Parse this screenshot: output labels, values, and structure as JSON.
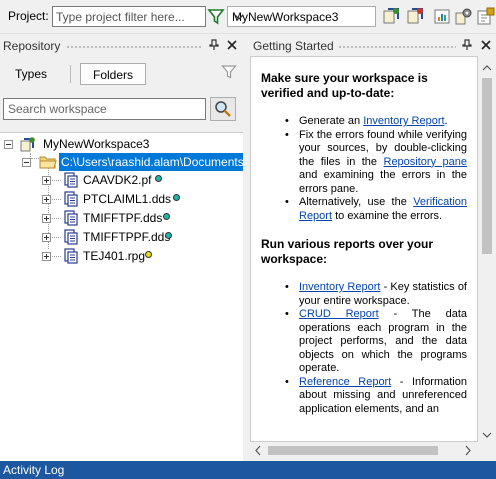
{
  "toolbar": {
    "project_label": "Project:",
    "project_placeholder": "Type project filter here...",
    "workspace_selected": "MyNewWorkspace3"
  },
  "repository": {
    "title": "Repository",
    "tab_types": "Types",
    "tab_folders": "Folders",
    "search_placeholder": "Search workspace",
    "tree": {
      "root": "MyNewWorkspace3",
      "folder": "C:\\Users\\raashid.alam\\Documents",
      "files": [
        {
          "name": "CAAVDK2.pf",
          "status": "teal"
        },
        {
          "name": "PTCLAIML1.dds",
          "status": "teal"
        },
        {
          "name": "TMIFFTPF.dds",
          "status": "teal"
        },
        {
          "name": "TMIFFTPPF.dds",
          "status": "teal"
        },
        {
          "name": "TEJ401.rpg",
          "status": "yellow"
        }
      ]
    }
  },
  "getting_started": {
    "title": "Getting Started",
    "section1": {
      "heading": "Make sure your workspace is verified and up-to-date:",
      "item1_pre": "Generate an ",
      "item1_link": "Inventory Report",
      "item1_post": ".",
      "item2_pre": "Fix the errors found while verifying your sources, by double-clicking the files in the ",
      "item2_link": "Repository pane",
      "item2_post": " and examining the errors in the errors pane.",
      "item3_pre": "Alternatively, use the ",
      "item3_link": "Verification Report",
      "item3_post": " to examine the errors."
    },
    "section2": {
      "heading": "Run various reports over your workspace:",
      "item1_link": "Inventory Report",
      "item1_post": " - Key statistics of your entire workspace.",
      "item2_link": "CRUD Report",
      "item2_post": " - The data operations each program in the project performs, and the data objects on which the programs operate.",
      "item3_link": "Reference Report",
      "item3_post": " - Information about missing and unreferenced application elements, and an"
    }
  },
  "bottom": {
    "activity_log": "Activity Log"
  },
  "colors": {
    "selection": "#0078d7",
    "link": "#0645ad",
    "status_teal": "#1fb5a8",
    "status_yellow": "#e8d820",
    "bottom_bar": "#1c57a0"
  }
}
